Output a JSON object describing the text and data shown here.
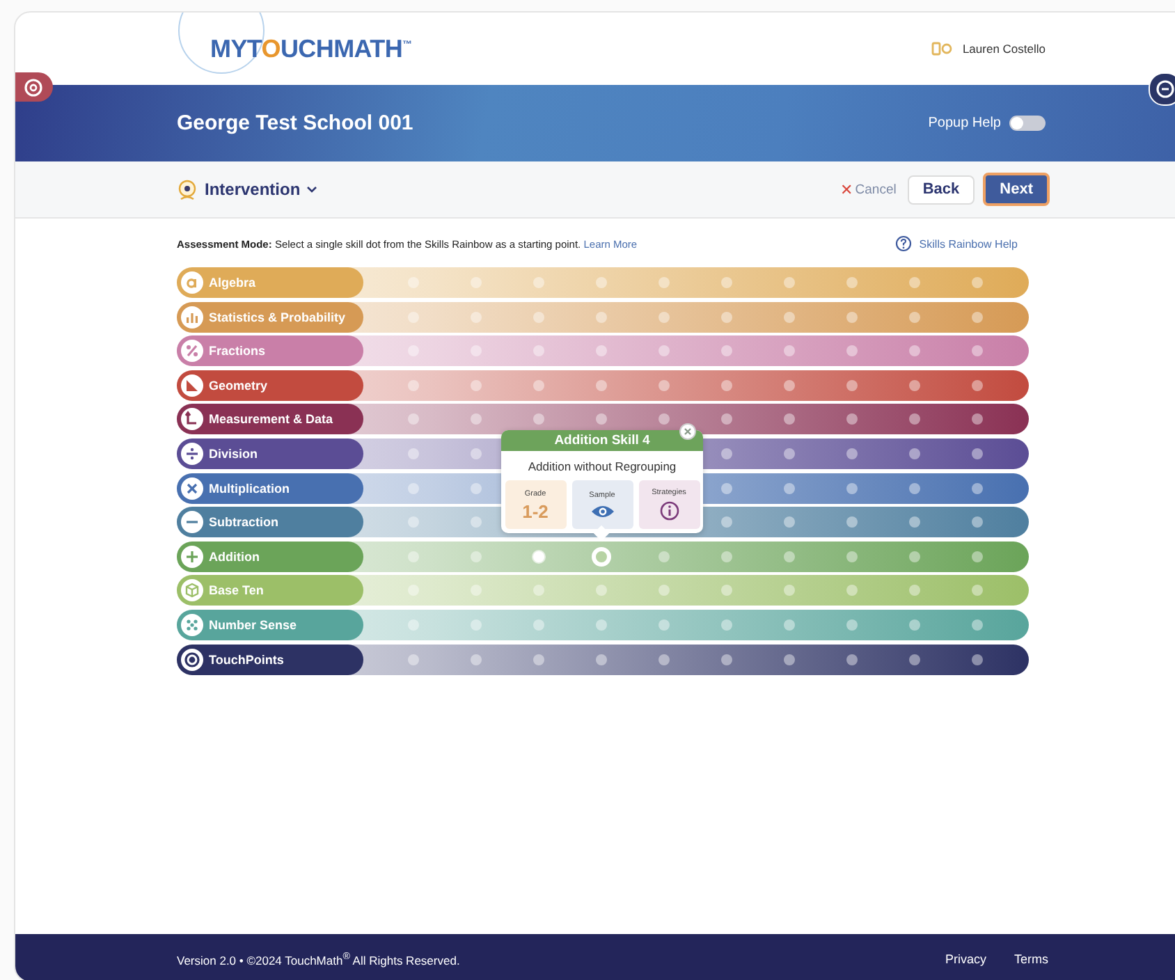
{
  "header": {
    "logo_parts": [
      "MYT",
      "O",
      "UCHMATH"
    ],
    "logo_mark": "™",
    "user": "Lauren Costello"
  },
  "banner": {
    "title": "George Test School 001",
    "popup_help": {
      "label": "Popup Help",
      "on": false
    }
  },
  "toolbar": {
    "menu": "Intervention",
    "cancel": "Cancel",
    "cancel_mark": "✕",
    "back": "Back",
    "next": "Next"
  },
  "instructions": {
    "text": "**Assessment Mode:** Select a single skill dot from the Skills Rainbow as a starting point.",
    "link": "Learn More",
    "help": "Skills Rainbow Help"
  },
  "rows": [
    {
      "name": "Algebra",
      "color": "#dfab58"
    },
    {
      "name": "Statistics & Probability",
      "color": "#d69a55"
    },
    {
      "name": "Fractions",
      "color": "#c97fa8"
    },
    {
      "name": "Geometry",
      "color": "#c24b3f"
    },
    {
      "name": "Measurement & Data",
      "color": "#8a3154"
    },
    {
      "name": "Division",
      "color": "#5b4d95"
    },
    {
      "name": "Multiplication",
      "color": "#4870b0"
    },
    {
      "name": "Subtraction",
      "color": "#4f7f9f"
    },
    {
      "name": "Addition",
      "color": "#6ba459",
      "dots": [
        {
          "done": false,
          "selected": false
        },
        {
          "done": false,
          "selected": false
        },
        {
          "done": true,
          "selected": false
        },
        {
          "done": false,
          "selected": true
        },
        {
          "done": false,
          "selected": false
        },
        {
          "done": false,
          "selected": false
        },
        {
          "done": false,
          "selected": false
        },
        {
          "done": false,
          "selected": false
        },
        {
          "done": false,
          "selected": false
        },
        {
          "done": false,
          "selected": false
        }
      ]
    },
    {
      "name": "Base Ten",
      "color": "#9cbf68"
    },
    {
      "name": "Number Sense",
      "color": "#58a59c"
    },
    {
      "name": "TouchPoints",
      "color": "#2d3264"
    }
  ],
  "popover": {
    "title": "Addition Skill 4",
    "description": "Addition without Regrouping",
    "tiles": [
      {
        "label": "Grade",
        "kind": "text",
        "value": "1-2",
        "color": "#fbeedf"
      },
      {
        "label": "Sample",
        "kind": "eye",
        "color": "#e6ebf3"
      },
      {
        "label": "Strategies",
        "kind": "info",
        "color": "#f2e5ee"
      }
    ]
  },
  "footer": {
    "text": "Version 2.0 • ©2024 TouchMath$^{®}$ All Rights Reserved.",
    "links": [
      "Privacy",
      "Terms"
    ]
  }
}
